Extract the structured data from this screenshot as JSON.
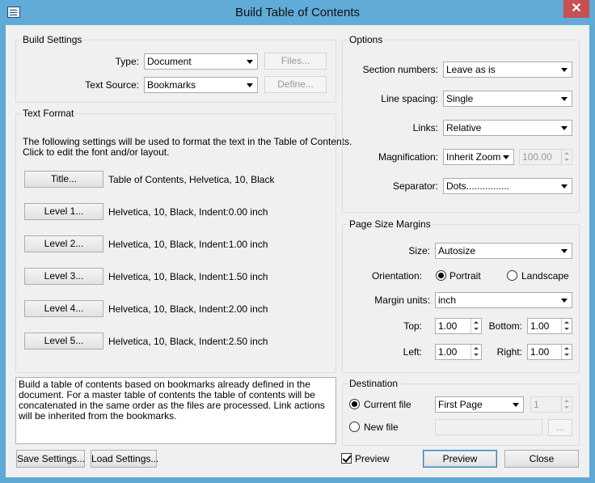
{
  "window": {
    "title": "Build Table of Contents",
    "close_label": "✕"
  },
  "build_settings": {
    "title": "Build Settings",
    "type_label": "Type:",
    "type_value": "Document",
    "files_button": "Files...",
    "source_label": "Text Source:",
    "source_value": "Bookmarks",
    "define_button": "Define..."
  },
  "text_format": {
    "title": "Text Format",
    "description": "The following settings will be used to format the text in the Table of Contents.",
    "description2": "Click to edit the font and/or layout.",
    "rows": [
      {
        "button": "Title...",
        "desc": "Table of Contents, Helvetica, 10, Black"
      },
      {
        "button": "Level 1...",
        "desc": "Helvetica, 10, Black, Indent:0.00 inch"
      },
      {
        "button": "Level 2...",
        "desc": "Helvetica, 10, Black, Indent:1.00 inch"
      },
      {
        "button": "Level 3...",
        "desc": "Helvetica, 10, Black, Indent:1.50 inch"
      },
      {
        "button": "Level 4...",
        "desc": "Helvetica, 10, Black, Indent:2.00 inch"
      },
      {
        "button": "Level 5...",
        "desc": "Helvetica, 10, Black, Indent:2.50 inch"
      }
    ]
  },
  "info_text": "Build a table of contents based on bookmarks already defined in the document. For a master table of contents the table of contents will be concatenated in the same order as the files are processed. Link actions will be inherited from the bookmarks.",
  "options": {
    "title": "Options",
    "section_label": "Section numbers:",
    "section_value": "Leave as is",
    "spacing_label": "Line spacing:",
    "spacing_value": "Single",
    "links_label": "Links:",
    "links_value": "Relative",
    "mag_label": "Magnification:",
    "mag_value": "Inherit Zoom",
    "mag_percent": "100.00",
    "sep_label": "Separator:",
    "sep_value": "Dots................"
  },
  "margins": {
    "title": "Page Size Margins",
    "size_label": "Size:",
    "size_value": "Autosize",
    "orientation_label": "Orientation:",
    "portrait": "Portrait",
    "landscape": "Landscape",
    "units_label": "Margin units:",
    "units_value": "inch",
    "top_label": "Top:",
    "top_value": "1.00",
    "bottom_label": "Bottom:",
    "bottom_value": "1.00",
    "left_label": "Left:",
    "left_value": "1.00",
    "right_label": "Right:",
    "right_value": "1.00"
  },
  "destination": {
    "title": "Destination",
    "current_file": "Current file",
    "position_value": "First Page",
    "page_value": "1",
    "new_file": "New file",
    "browse": "..."
  },
  "footer": {
    "save": "Save Settings...",
    "load": "Load Settings...",
    "preview_check": "Preview",
    "preview_button": "Preview",
    "close_button": "Close"
  }
}
